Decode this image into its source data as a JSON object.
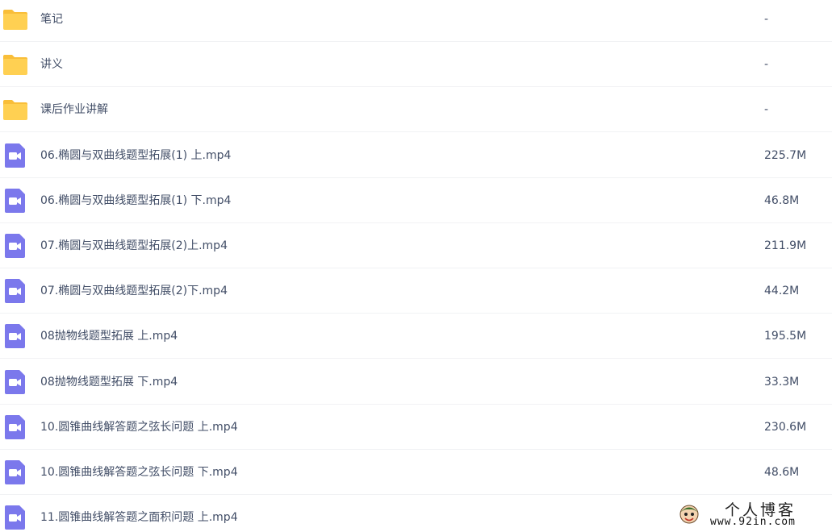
{
  "colors": {
    "folder": "#ffd052",
    "folder_tab": "#f9be39",
    "video": "#7b78ec",
    "text": "#424e67",
    "divider": "#f1f2f4"
  },
  "rows": [
    {
      "type": "folder",
      "icon": "folder-icon",
      "name": "笔记",
      "size": "-"
    },
    {
      "type": "folder",
      "icon": "folder-icon",
      "name": "讲义",
      "size": "-"
    },
    {
      "type": "folder",
      "icon": "folder-icon",
      "name": "课后作业讲解",
      "size": "-"
    },
    {
      "type": "video",
      "icon": "video-file-icon",
      "name": "06.椭圆与双曲线题型拓展(1) 上.mp4",
      "size": "225.7M"
    },
    {
      "type": "video",
      "icon": "video-file-icon",
      "name": "06.椭圆与双曲线题型拓展(1) 下.mp4",
      "size": "46.8M"
    },
    {
      "type": "video",
      "icon": "video-file-icon",
      "name": "07.椭圆与双曲线题型拓展(2)上.mp4",
      "size": "211.9M"
    },
    {
      "type": "video",
      "icon": "video-file-icon",
      "name": "07.椭圆与双曲线题型拓展(2)下.mp4",
      "size": "44.2M"
    },
    {
      "type": "video",
      "icon": "video-file-icon",
      "name": "08抛物线题型拓展 上.mp4",
      "size": "195.5M"
    },
    {
      "type": "video",
      "icon": "video-file-icon",
      "name": "08抛物线题型拓展 下.mp4",
      "size": "33.3M"
    },
    {
      "type": "video",
      "icon": "video-file-icon",
      "name": "10.圆锥曲线解答题之弦长问题 上.mp4",
      "size": "230.6M"
    },
    {
      "type": "video",
      "icon": "video-file-icon",
      "name": "10.圆锥曲线解答题之弦长问题 下.mp4",
      "size": "48.6M"
    },
    {
      "type": "video",
      "icon": "video-file-icon",
      "name": "11.圆锥曲线解答题之面积问题 上.mp4",
      "size": ""
    }
  ],
  "watermark": {
    "title": "个人博客",
    "url": "www.92in.com"
  }
}
